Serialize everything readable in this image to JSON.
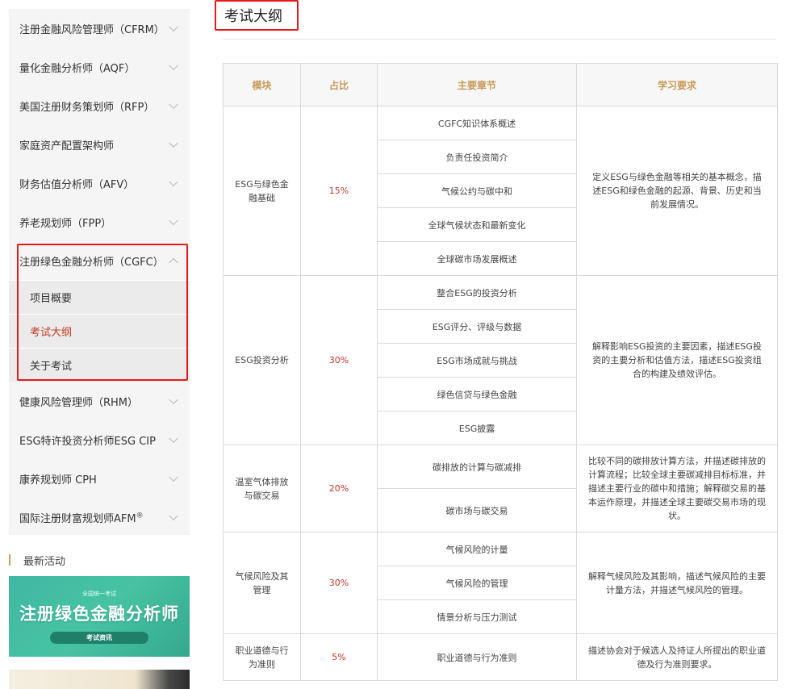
{
  "sidebar": {
    "items": [
      {
        "label": "注册金融风险管理师（CFRM）"
      },
      {
        "label": "量化金融分析师（AQF）"
      },
      {
        "label": "美国注册财务策划师（RFP）"
      },
      {
        "label": "家庭资产配置架构师"
      },
      {
        "label": "财务估值分析师（AFV）"
      },
      {
        "label": "养老规划师（FPP）"
      },
      {
        "label": "注册绿色金融分析师（CGFC）"
      },
      {
        "label": "健康风险管理师（RHM）"
      },
      {
        "label": "ESG特许投资分析师ESG CIP"
      },
      {
        "label": "康养规划师 CPH"
      },
      {
        "label": "国际注册财富规划师AFM",
        "sup": "®"
      }
    ],
    "subitems": [
      {
        "label": "项目概要"
      },
      {
        "label": "考试大纲"
      },
      {
        "label": "关于考试"
      }
    ],
    "news_heading": "最新活动",
    "banner": {
      "small_text": "全国统一考试",
      "title": "注册绿色金融分析师",
      "pill": "考试资讯"
    }
  },
  "main": {
    "title": "考试大纲",
    "headers": [
      "模块",
      "占比",
      "主要章节",
      "学习要求"
    ],
    "modules": [
      {
        "name": "ESG与绿色金融基础",
        "ratio": "15%",
        "chapters": [
          "CGFC知识体系概述",
          "负责任投资简介",
          "气候公约与碳中和",
          "全球气候状态和最新变化",
          "全球碳市场发展概述"
        ],
        "requirement": "定义ESG与绿色金融等相关的基本概念，描述ESG和绿色金融的起源、背景、历史和当前发展情况。"
      },
      {
        "name": "ESG投资分析",
        "ratio": "30%",
        "chapters": [
          "整合ESG的投资分析",
          "ESG评分、评级与数据",
          "ESG市场成就与挑战",
          "绿色信贷与绿色金融",
          "ESG披露"
        ],
        "requirement": "解释影响ESG投资的主要因素，描述ESG投资的主要分析和估值方法，描述ESG投资组合的构建及绩效评估。"
      },
      {
        "name": "温室气体排放与碳交易",
        "ratio": "20%",
        "chapters": [
          "碳排放的计算与碳减排",
          "碳市场与碳交易"
        ],
        "requirement": "比较不同的碳排放计算方法，并描述碳排放的计算流程；比较全球主要碳减排目标标准，并描述主要行业的碳中和措施；解释碳交易的基本运作原理，并描述全球主要碳交易市场的现状。"
      },
      {
        "name": "气候风险及其管理",
        "ratio": "30%",
        "chapters": [
          "气候风险的计量",
          "气候风险的管理",
          "情景分析与压力测试"
        ],
        "requirement": "解释气候风险及其影响，描述气候风险的主要计量方法，并描述气候风险的管理。"
      },
      {
        "name": "职业道德与行为准则",
        "ratio": "5%",
        "chapters": [
          "职业道德与行为准则"
        ],
        "requirement": "描述协会对于候选人及持证人所提出的职业道德及行为准则要求。"
      }
    ]
  }
}
